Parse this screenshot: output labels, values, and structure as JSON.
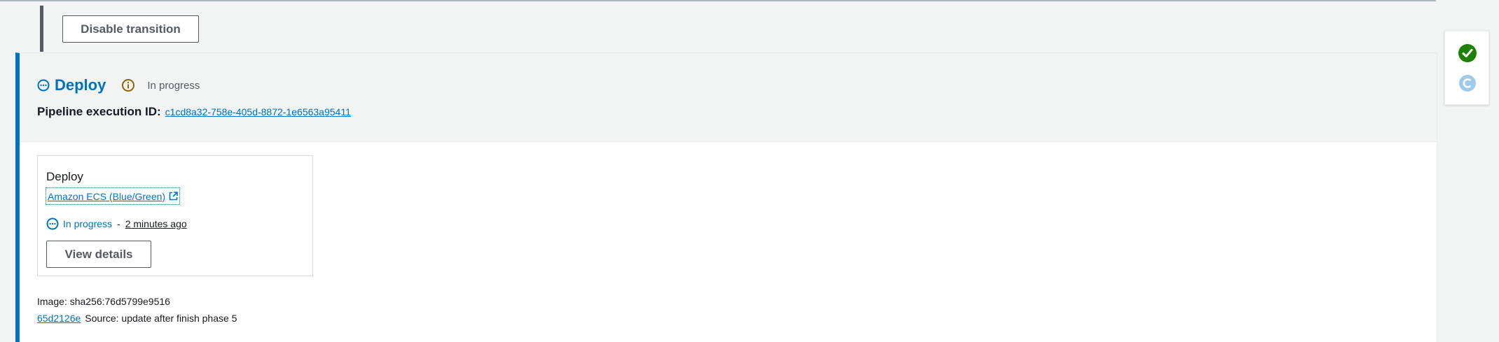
{
  "transition": {
    "disable_label": "Disable transition"
  },
  "stage": {
    "name": "Deploy",
    "status": "In progress",
    "execution_label": "Pipeline execution ID:",
    "execution_id": "c1cd8a32-758e-405d-8872-1e6563a95411"
  },
  "action": {
    "name": "Deploy",
    "provider": "Amazon ECS (Blue/Green)",
    "status": "In progress",
    "separator": "-",
    "time_ago": "2 minutes ago",
    "view_details_label": "View details"
  },
  "artifacts": {
    "image": "Image: sha256:76d5799e9516",
    "commit_id": "65d2126e",
    "commit_message": "Source: update after finish phase 5"
  },
  "side_panel": {
    "icons": [
      "success-icon",
      "in-progress-icon"
    ]
  },
  "colors": {
    "accent": "#0073bb",
    "success": "#1d8102",
    "in_progress_light": "#a0cbe8",
    "info_warning": "#8d6605"
  }
}
